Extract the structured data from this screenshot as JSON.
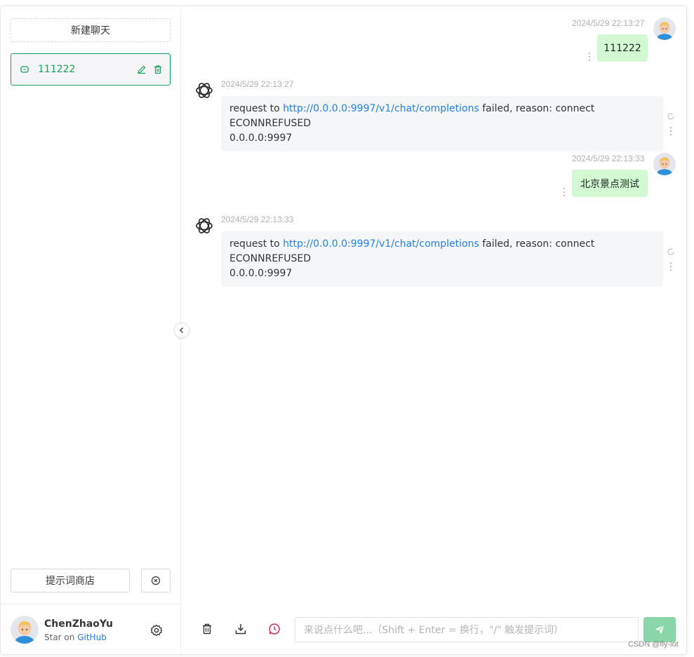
{
  "sidebar": {
    "new_chat_label": "新建聊天",
    "conversations": [
      {
        "label": "111222"
      }
    ],
    "prompt_store_label": "提示词商店",
    "user": {
      "name": "ChenZhaoYu",
      "star_prefix": "Star on",
      "star_link": "GitHub"
    }
  },
  "messages": [
    {
      "role": "user",
      "time": "2024/5/29 22:13:27",
      "text": "111222"
    },
    {
      "role": "assistant",
      "time": "2024/5/29 22:13:27",
      "pre": "request to ",
      "link": "http://0.0.0.0:9997/v1/chat/completions",
      "post": " failed, reason: connect ECONNREFUSED",
      "line2": "0.0.0.0:9997"
    },
    {
      "role": "user",
      "time": "2024/5/29 22:13:33",
      "text": "北京景点测试"
    },
    {
      "role": "assistant",
      "time": "2024/5/29 22:13:33",
      "pre": "request to ",
      "link": "http://0.0.0.0:9997/v1/chat/completions",
      "post": " failed, reason: connect ECONNREFUSED",
      "line2": "0.0.0.0:9997"
    }
  ],
  "footer": {
    "input_placeholder": "来说点什么吧...（Shift + Enter = 换行，\"/\" 触发提示词）",
    "tools": [
      "trash-icon",
      "download-icon",
      "chat-history-icon"
    ]
  },
  "watermark": "CSDN @fly-iot",
  "colors": {
    "accent": "#18a058",
    "user_bubble": "#d2f9d1",
    "bot_bubble": "#f4f6f8",
    "link": "#2080f0",
    "send": "#8bd6a8"
  }
}
